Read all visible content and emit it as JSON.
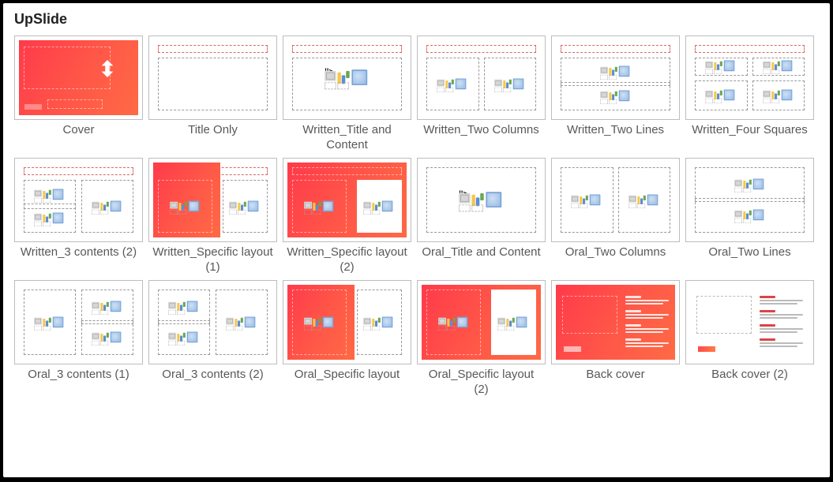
{
  "section_title": "UpSlide",
  "layouts": [
    {
      "id": "cover",
      "label": "Cover",
      "kind": "cover"
    },
    {
      "id": "title-only",
      "label": "Title Only",
      "kind": "title_only"
    },
    {
      "id": "written-title-content",
      "label": "Written_Title and Content",
      "kind": "content_single",
      "oral": false
    },
    {
      "id": "written-two-columns",
      "label": "Written_Two Columns",
      "kind": "two_cols",
      "oral": false
    },
    {
      "id": "written-two-lines",
      "label": "Written_Two Lines",
      "kind": "two_lines",
      "oral": false
    },
    {
      "id": "written-four-squares",
      "label": "Written_Four Squares",
      "kind": "four_sq",
      "oral": false
    },
    {
      "id": "written-3-contents-2",
      "label": "Written_3 contents (2)",
      "kind": "three_2",
      "oral": false
    },
    {
      "id": "written-specific-1",
      "label": "Written_Specific layout (1)",
      "kind": "specific_half_red",
      "oral": false
    },
    {
      "id": "written-specific-2",
      "label": "Written_Specific layout (2)",
      "kind": "specific_full_red",
      "oral": false
    },
    {
      "id": "oral-title-content",
      "label": "Oral_Title and Content",
      "kind": "content_single",
      "oral": true
    },
    {
      "id": "oral-two-columns",
      "label": "Oral_Two Columns",
      "kind": "two_cols",
      "oral": true
    },
    {
      "id": "oral-two-lines",
      "label": "Oral_Two Lines",
      "kind": "two_lines",
      "oral": true
    },
    {
      "id": "oral-3-contents-1",
      "label": "Oral_3 contents (1)",
      "kind": "three_1",
      "oral": true
    },
    {
      "id": "oral-3-contents-2",
      "label": "Oral_3 contents (2)",
      "kind": "three_2",
      "oral": true
    },
    {
      "id": "oral-specific",
      "label": "Oral_Specific layout",
      "kind": "specific_half_red",
      "oral": true
    },
    {
      "id": "oral-specific-2",
      "label": "Oral_Specific layout (2)",
      "kind": "specific_full_red",
      "oral": true
    },
    {
      "id": "back-cover",
      "label": "Back cover",
      "kind": "back_red"
    },
    {
      "id": "back-cover-2",
      "label": "Back cover (2)",
      "kind": "back_white"
    }
  ],
  "colors": {
    "brand_gradient_start": "#ff3a4a",
    "brand_gradient_end": "#ff6a44",
    "label_text": "#585858",
    "thumb_border": "#bdbdbd"
  }
}
